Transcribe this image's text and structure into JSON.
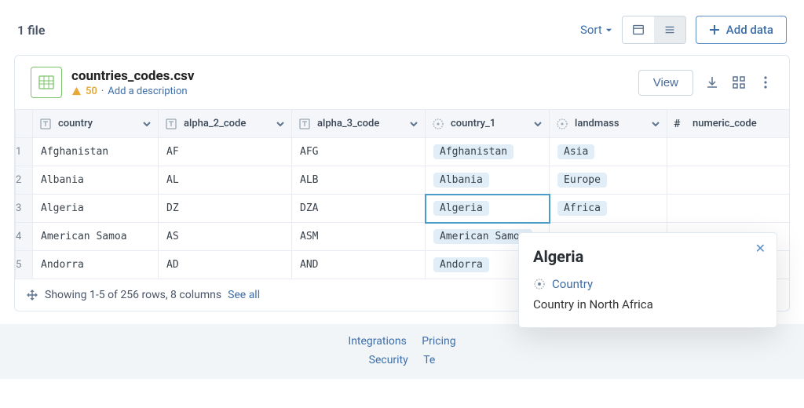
{
  "topbar": {
    "file_count_label": "1 file",
    "sort_label": "Sort",
    "add_data_label": "Add data"
  },
  "file": {
    "name": "countries_codes.csv",
    "warning_count": "50",
    "meta_sep": " · ",
    "add_description_label": "Add a description",
    "view_button_label": "View"
  },
  "columns": [
    {
      "name": "country",
      "type": "text"
    },
    {
      "name": "alpha_2_code",
      "type": "text"
    },
    {
      "name": "alpha_3_code",
      "type": "text"
    },
    {
      "name": "country_1",
      "type": "entity"
    },
    {
      "name": "landmass",
      "type": "entity"
    },
    {
      "name": "numeric_code",
      "type": "number"
    }
  ],
  "rows": [
    {
      "idx": "1",
      "country": "Afghanistan",
      "alpha_2_code": "AF",
      "alpha_3_code": "AFG",
      "country_1": "Afghanistan",
      "landmass": "Asia",
      "numeric_code": ""
    },
    {
      "idx": "2",
      "country": "Albania",
      "alpha_2_code": "AL",
      "alpha_3_code": "ALB",
      "country_1": "Albania",
      "landmass": "Europe",
      "numeric_code": ""
    },
    {
      "idx": "3",
      "country": "Algeria",
      "alpha_2_code": "DZ",
      "alpha_3_code": "DZA",
      "country_1": "Algeria",
      "landmass": "Africa",
      "numeric_code": ""
    },
    {
      "idx": "4",
      "country": "American Samoa",
      "alpha_2_code": "AS",
      "alpha_3_code": "ASM",
      "country_1": "American Samoa",
      "landmass": "",
      "numeric_code": ""
    },
    {
      "idx": "5",
      "country": "Andorra",
      "alpha_2_code": "AD",
      "alpha_3_code": "AND",
      "country_1": "Andorra",
      "landmass": "",
      "numeric_code": ""
    }
  ],
  "pagination": {
    "text": "Showing 1-5 of 256 rows, 8 columns",
    "see_all": "See all"
  },
  "popover": {
    "title": "Algeria",
    "type_label": "Country",
    "description": "Country in North Africa"
  },
  "footer": {
    "integrations": "Integrations",
    "pricing": "Pricing",
    "security": "Security",
    "terms_prefix": "Te"
  }
}
